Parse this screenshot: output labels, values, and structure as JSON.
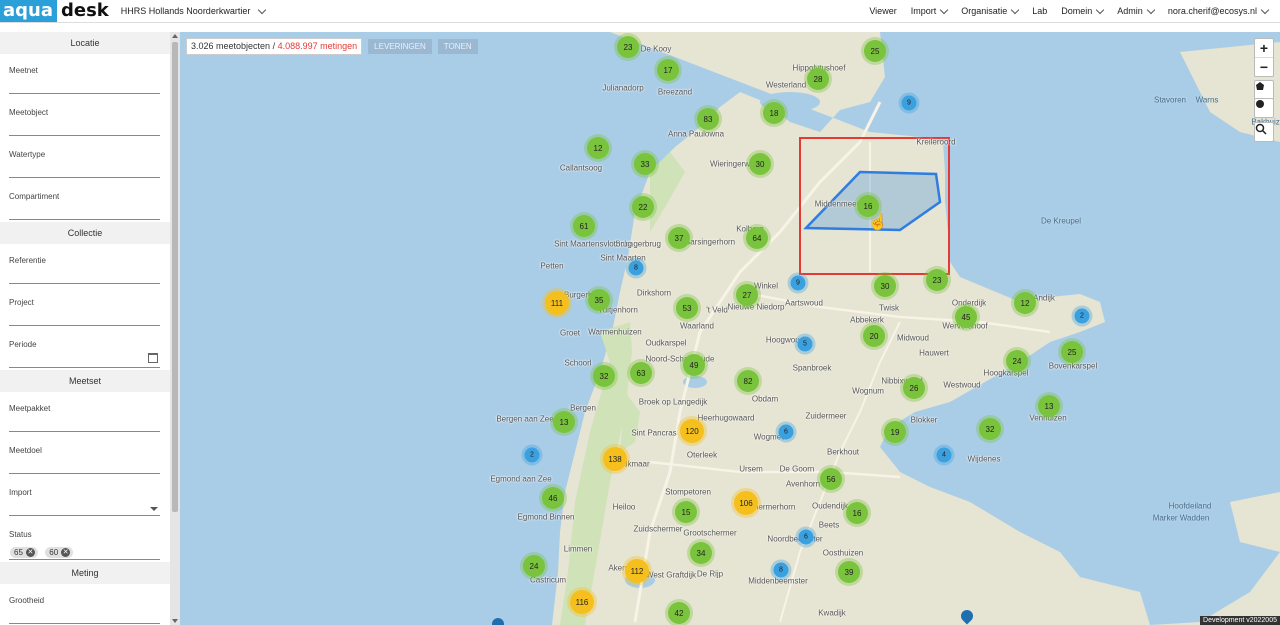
{
  "header": {
    "logo_left": "aqua",
    "logo_right": "desk",
    "org": "HHRS Hollands Noorderkwartier",
    "nav": [
      "Viewer",
      "Import",
      "Organisatie",
      "Lab",
      "Domein",
      "Admin",
      "nora.cherif@ecosys.nl"
    ]
  },
  "sidebar": {
    "sections": [
      {
        "title": "Locatie",
        "fields": [
          "Meetnet",
          "Meetobject",
          "Watertype",
          "Compartiment"
        ]
      },
      {
        "title": "Collectie",
        "fields": [
          "Referentie",
          "Project",
          "Periode"
        ]
      },
      {
        "title": "Meetset",
        "fields": [
          "Meetpakket",
          "Meetdoel",
          "Import",
          "Status"
        ]
      },
      {
        "title": "Meting",
        "fields": [
          "Grootheid"
        ]
      }
    ],
    "status_chips": [
      "65",
      "60"
    ]
  },
  "map": {
    "count_objects": "3.026 meetobjecten",
    "count_sep": " / ",
    "count_metingen": "4.088.997 metingen",
    "btn_leveringen": "LEVERINGEN",
    "btn_tonen": "TONEN",
    "version": "Development v2022005",
    "clusters": [
      {
        "n": "23",
        "c": "g"
      },
      {
        "n": "25",
        "c": "g"
      },
      {
        "n": "17",
        "c": "g"
      },
      {
        "n": "28",
        "c": "g"
      },
      {
        "n": "9",
        "c": "b"
      },
      {
        "n": "83",
        "c": "g"
      },
      {
        "n": "18",
        "c": "g"
      },
      {
        "n": "12",
        "c": "g"
      },
      {
        "n": "33",
        "c": "g"
      },
      {
        "n": "30",
        "c": "g"
      },
      {
        "n": "16",
        "c": "g"
      },
      {
        "n": "22",
        "c": "g"
      },
      {
        "n": "61",
        "c": "g"
      },
      {
        "n": "37",
        "c": "g"
      },
      {
        "n": "64",
        "c": "g"
      },
      {
        "n": "8",
        "c": "b"
      },
      {
        "n": "9",
        "c": "b"
      },
      {
        "n": "30",
        "c": "g"
      },
      {
        "n": "23",
        "c": "g"
      },
      {
        "n": "111",
        "c": "y"
      },
      {
        "n": "35",
        "c": "g"
      },
      {
        "n": "53",
        "c": "g"
      },
      {
        "n": "27",
        "c": "g"
      },
      {
        "n": "12",
        "c": "g"
      },
      {
        "n": "45",
        "c": "g"
      },
      {
        "n": "2",
        "c": "b"
      },
      {
        "n": "20",
        "c": "g"
      },
      {
        "n": "5",
        "c": "b"
      },
      {
        "n": "25",
        "c": "g"
      },
      {
        "n": "32",
        "c": "g"
      },
      {
        "n": "63",
        "c": "g"
      },
      {
        "n": "49",
        "c": "g"
      },
      {
        "n": "82",
        "c": "g"
      },
      {
        "n": "24",
        "c": "g"
      },
      {
        "n": "26",
        "c": "g"
      },
      {
        "n": "13",
        "c": "g"
      },
      {
        "n": "13",
        "c": "g"
      },
      {
        "n": "120",
        "c": "y"
      },
      {
        "n": "6",
        "c": "b"
      },
      {
        "n": "19",
        "c": "g"
      },
      {
        "n": "32",
        "c": "g"
      },
      {
        "n": "2",
        "c": "b"
      },
      {
        "n": "138",
        "c": "y"
      },
      {
        "n": "4",
        "c": "b"
      },
      {
        "n": "56",
        "c": "g"
      },
      {
        "n": "46",
        "c": "g"
      },
      {
        "n": "106",
        "c": "y"
      },
      {
        "n": "15",
        "c": "g"
      },
      {
        "n": "16",
        "c": "g"
      },
      {
        "n": "6",
        "c": "b"
      },
      {
        "n": "34",
        "c": "g"
      },
      {
        "n": "24",
        "c": "g"
      },
      {
        "n": "112",
        "c": "y"
      },
      {
        "n": "8",
        "c": "b"
      },
      {
        "n": "39",
        "c": "g"
      },
      {
        "n": "116",
        "c": "y"
      },
      {
        "n": "42",
        "c": "g"
      }
    ],
    "places": [
      "De Kooy",
      "Hippolytushoef",
      "Westerland",
      "Julianadorp",
      "Breezand",
      "Anna Paulowna",
      "Callantsoog",
      "Wieringerwaard",
      "Kreileroord",
      "Middenmeer",
      "De Kreupel",
      "Schagerbrug",
      "Sint Maartensvlotbrug",
      "Barsingerhorn",
      "Kolhorn",
      "Petten",
      "Sint Maarten",
      "Burgerbrug",
      "Tuitjenhorn",
      "Dirkshorn",
      "'t Veld",
      "Winkel",
      "Nieuwe Niedorp",
      "Aartswoud",
      "Twisk",
      "Onderdijk",
      "Wervershoof",
      "Groet",
      "Warmenhuizen",
      "Waarland",
      "Abbekerk",
      "Midwoud",
      "Hauwert",
      "Andijk",
      "Hoogwoud",
      "Oudkarspel",
      "Noord-Scharwoude",
      "Spanbroek",
      "Schoorl",
      "Nibbixwoud",
      "Westwoud",
      "Hoogkarspel",
      "Bovenkarspel",
      "Broek op Langedijk",
      "Obdam",
      "Wognum",
      "Bergen",
      "Bergen aan Zee",
      "Heerhugowaard",
      "Zuidermeer",
      "Blokker",
      "Venhuizen",
      "Sint Pancras",
      "Alkmaar",
      "Oterleek",
      "Wogmeer",
      "Berkhout",
      "Wijdenes",
      "Egmond aan Zee",
      "Ursem",
      "De Goorn",
      "Avenhorn",
      "Stompetoren",
      "Egmond Binnen",
      "Heiloo",
      "Schermerhorn",
      "Oudendijk",
      "Beets",
      "Zuidschermer",
      "Grootschermer",
      "Noordbeemster",
      "Oosthuizen",
      "Limmen",
      "Akersloot",
      "West Graftdijk",
      "De Rijp",
      "Middenbeemster",
      "Castricum",
      "Kwadijk",
      "Hoofdeiland",
      "Marker Wadden",
      "Stavoren",
      "Warns",
      "Bakhuizen"
    ]
  }
}
